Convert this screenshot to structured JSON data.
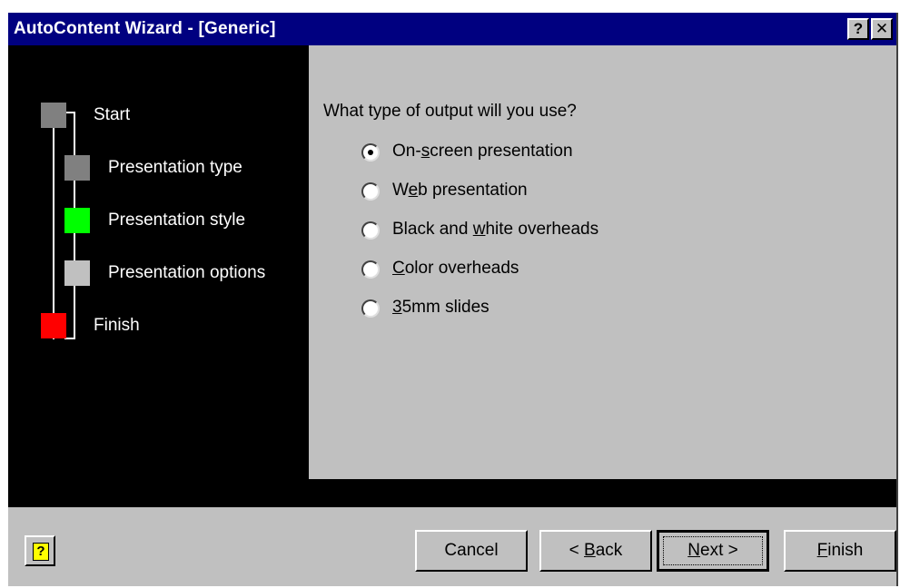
{
  "window": {
    "title": "AutoContent Wizard - [Generic]",
    "help_glyph": "?",
    "close_glyph": "✕"
  },
  "steps": [
    {
      "label": "Start",
      "color": "#808080"
    },
    {
      "label": "Presentation type",
      "color": "#808080"
    },
    {
      "label": "Presentation style",
      "color": "#00ff00"
    },
    {
      "label": "Presentation options",
      "color": "#c0c0c0"
    },
    {
      "label": "Finish",
      "color": "#ff0000"
    }
  ],
  "question": "What type of output will you use?",
  "options": [
    {
      "pre": "On-",
      "u": "s",
      "post": "creen presentation",
      "checked": true
    },
    {
      "pre": "W",
      "u": "e",
      "post": "b presentation",
      "checked": false
    },
    {
      "pre": "Black and ",
      "u": "w",
      "post": "hite overheads",
      "checked": false
    },
    {
      "pre": "",
      "u": "C",
      "post": "olor overheads",
      "checked": false
    },
    {
      "pre": "",
      "u": "3",
      "post": "5mm slides",
      "checked": false
    }
  ],
  "buttons": {
    "cancel": {
      "pre": "Cancel",
      "u": "",
      "post": ""
    },
    "back": {
      "pre": "< ",
      "u": "B",
      "post": "ack"
    },
    "next": {
      "pre": "",
      "u": "N",
      "post": "ext >"
    },
    "finish": {
      "pre": "",
      "u": "F",
      "post": "inish"
    },
    "help_icon_glyph": "?"
  }
}
